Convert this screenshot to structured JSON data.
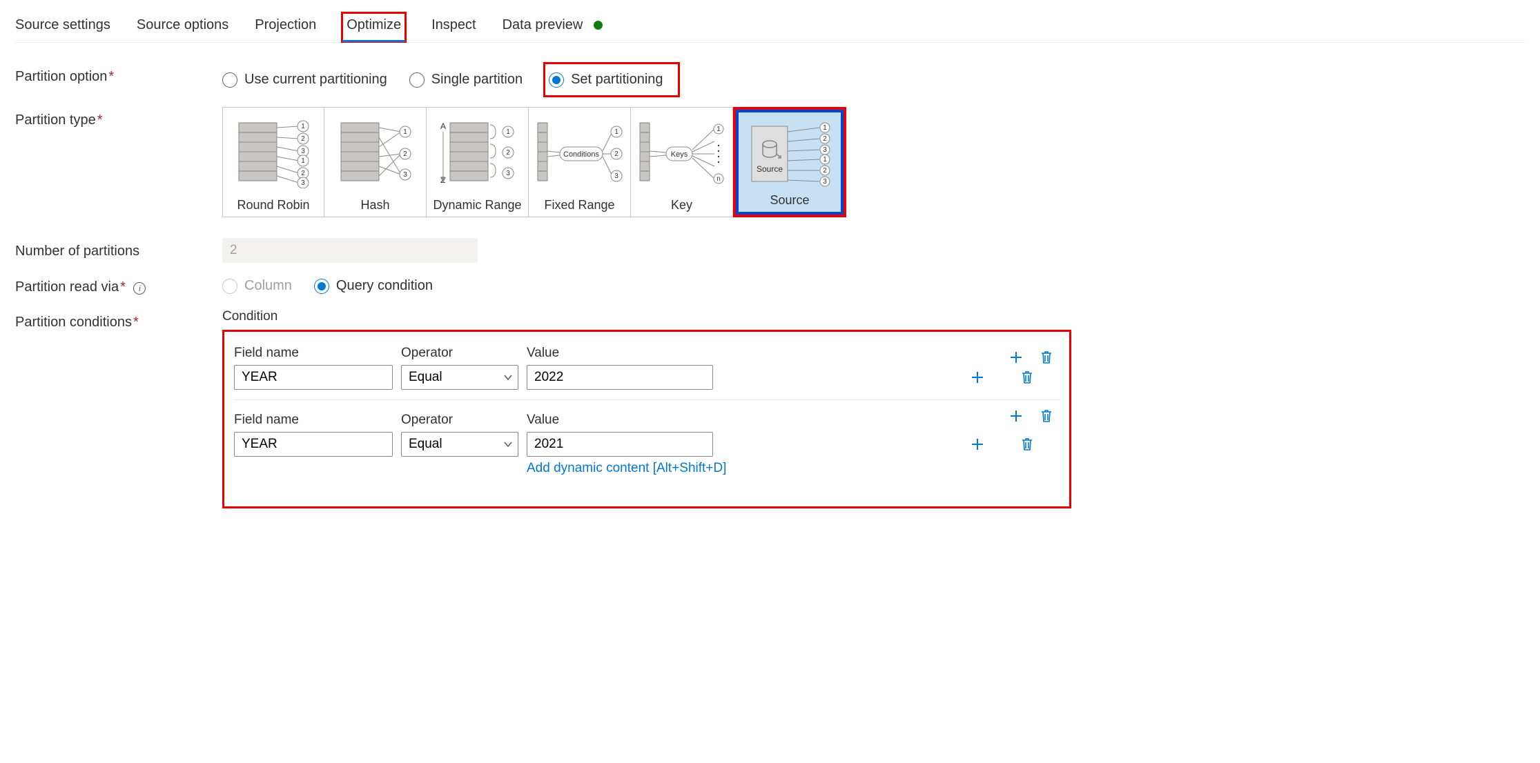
{
  "tabs": {
    "source_settings": "Source settings",
    "source_options": "Source options",
    "projection": "Projection",
    "optimize": "Optimize",
    "inspect": "Inspect",
    "data_preview": "Data preview"
  },
  "labels": {
    "partition_option": "Partition option",
    "partition_type": "Partition type",
    "number_of_partitions": "Number of partitions",
    "partition_read_via": "Partition read via",
    "partition_conditions": "Partition conditions",
    "condition": "Condition",
    "field_name": "Field name",
    "operator": "Operator",
    "value": "Value"
  },
  "radios": {
    "use_current": "Use current partitioning",
    "single": "Single partition",
    "set": "Set partitioning",
    "column": "Column",
    "query": "Query condition"
  },
  "partition_types": {
    "round_robin": "Round Robin",
    "hash": "Hash",
    "dynamic_range": "Dynamic Range",
    "fixed_range": "Fixed Range",
    "key": "Key",
    "source": "Source"
  },
  "values": {
    "num_partitions": "2"
  },
  "conditions": [
    {
      "field": "YEAR",
      "operator": "Equal",
      "value": "2022"
    },
    {
      "field": "YEAR",
      "operator": "Equal",
      "value": "2021"
    }
  ],
  "links": {
    "add_dynamic": "Add dynamic content [Alt+Shift+D]"
  }
}
